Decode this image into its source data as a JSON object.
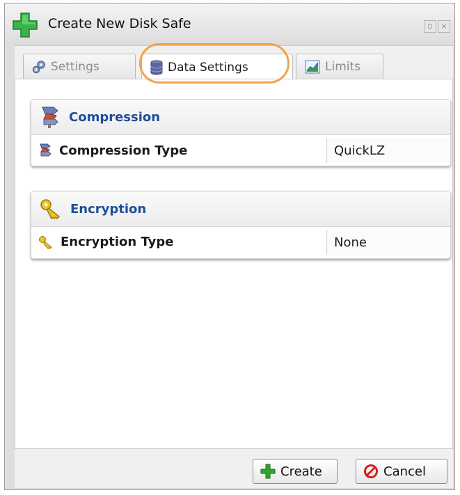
{
  "window": {
    "title": "Create New Disk Safe",
    "icon": "green-plus-icon",
    "controls": [
      "restore-icon",
      "close-icon"
    ]
  },
  "tabs": [
    {
      "label": "Settings",
      "icon": "gears-icon",
      "active": false
    },
    {
      "label": "Data Settings",
      "icon": "database-icon",
      "active": true
    },
    {
      "label": "Limits",
      "icon": "chart-icon",
      "active": false
    }
  ],
  "sections": {
    "compression": {
      "title": "Compression",
      "icon": "compression-icon",
      "field_label": "Compression Type",
      "field_value": "QuickLZ"
    },
    "encryption": {
      "title": "Encryption",
      "icon": "key-icon",
      "field_label": "Encryption Type",
      "field_value": "None"
    }
  },
  "buttons": {
    "create": "Create",
    "cancel": "Cancel"
  },
  "colors": {
    "accent": "#1f4e96",
    "highlight": "#f3a14b",
    "create_icon": "#2ea62e",
    "cancel_icon": "#d02020"
  }
}
